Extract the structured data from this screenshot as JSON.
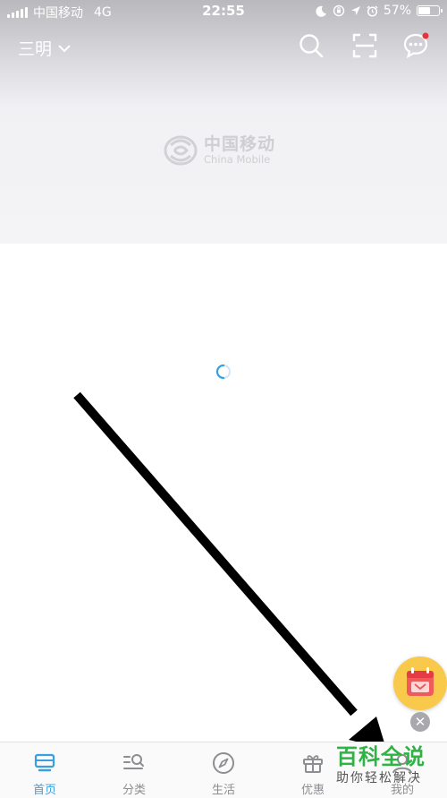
{
  "status_bar": {
    "carrier": "中国移动",
    "network": "4G",
    "time": "22:55",
    "battery_text": "57%",
    "battery_level": 0.57
  },
  "header": {
    "city": "三明",
    "icons": [
      "search-icon",
      "scan-icon",
      "message-icon"
    ],
    "has_unread_dot": true
  },
  "banner": {
    "logo_cn": "中国移动",
    "logo_en": "China Mobile"
  },
  "tabbar": {
    "tabs": [
      {
        "label": "首页",
        "icon": "home-icon",
        "active": true
      },
      {
        "label": "分类",
        "icon": "category-icon",
        "active": false
      },
      {
        "label": "生活",
        "icon": "compass-icon",
        "active": false
      },
      {
        "label": "优惠",
        "icon": "gift-icon",
        "active": false
      },
      {
        "label": "我的",
        "icon": "profile-icon",
        "active": false
      }
    ]
  },
  "watermark": {
    "title": "百科全说",
    "subtitle": "助你轻松解决"
  },
  "colors": {
    "accent": "#3a9fe0",
    "watermark_green": "#2fb344",
    "float_badge": "#f8c94a"
  }
}
